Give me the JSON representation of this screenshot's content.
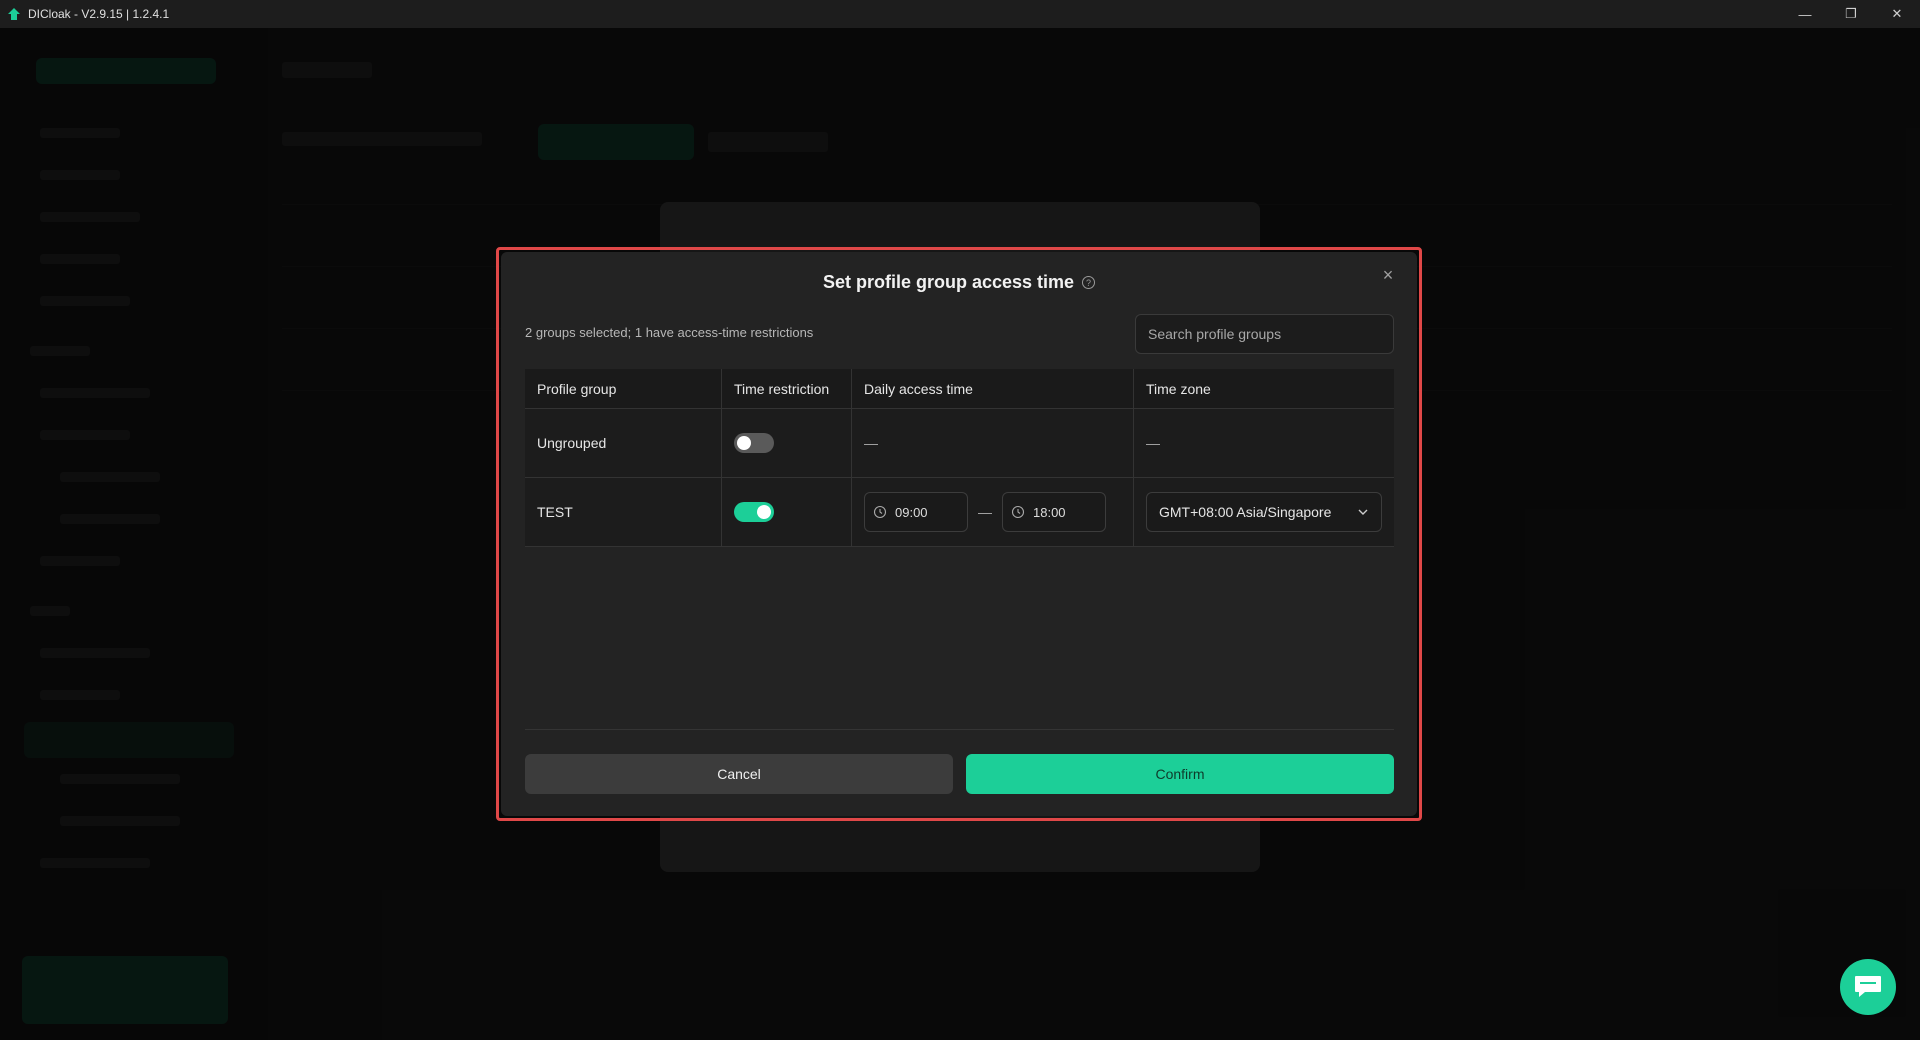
{
  "window": {
    "title": "DICloak - V2.9.15 | 1.2.4.1",
    "minimize_icon": "minimize-icon",
    "maximize_icon": "restore-icon",
    "close_icon": "close-icon"
  },
  "modal": {
    "title": "Set profile group access time",
    "summary": "2 groups selected; 1 have access-time restrictions",
    "search_placeholder": "Search profile groups",
    "columns": [
      "Profile group",
      "Time restriction",
      "Daily access time",
      "Time zone"
    ],
    "rows": [
      {
        "group": "Ungrouped",
        "restricted": false,
        "start": "—",
        "end": "",
        "timezone": "—"
      },
      {
        "group": "TEST",
        "restricted": true,
        "start": "09:00",
        "end": "18:00",
        "timezone": "GMT+08:00 Asia/Singapore"
      }
    ],
    "time_separator": "—",
    "cancel_label": "Cancel",
    "confirm_label": "Confirm"
  },
  "colors": {
    "accent": "#1ccf98",
    "highlight_frame": "#e04848"
  }
}
